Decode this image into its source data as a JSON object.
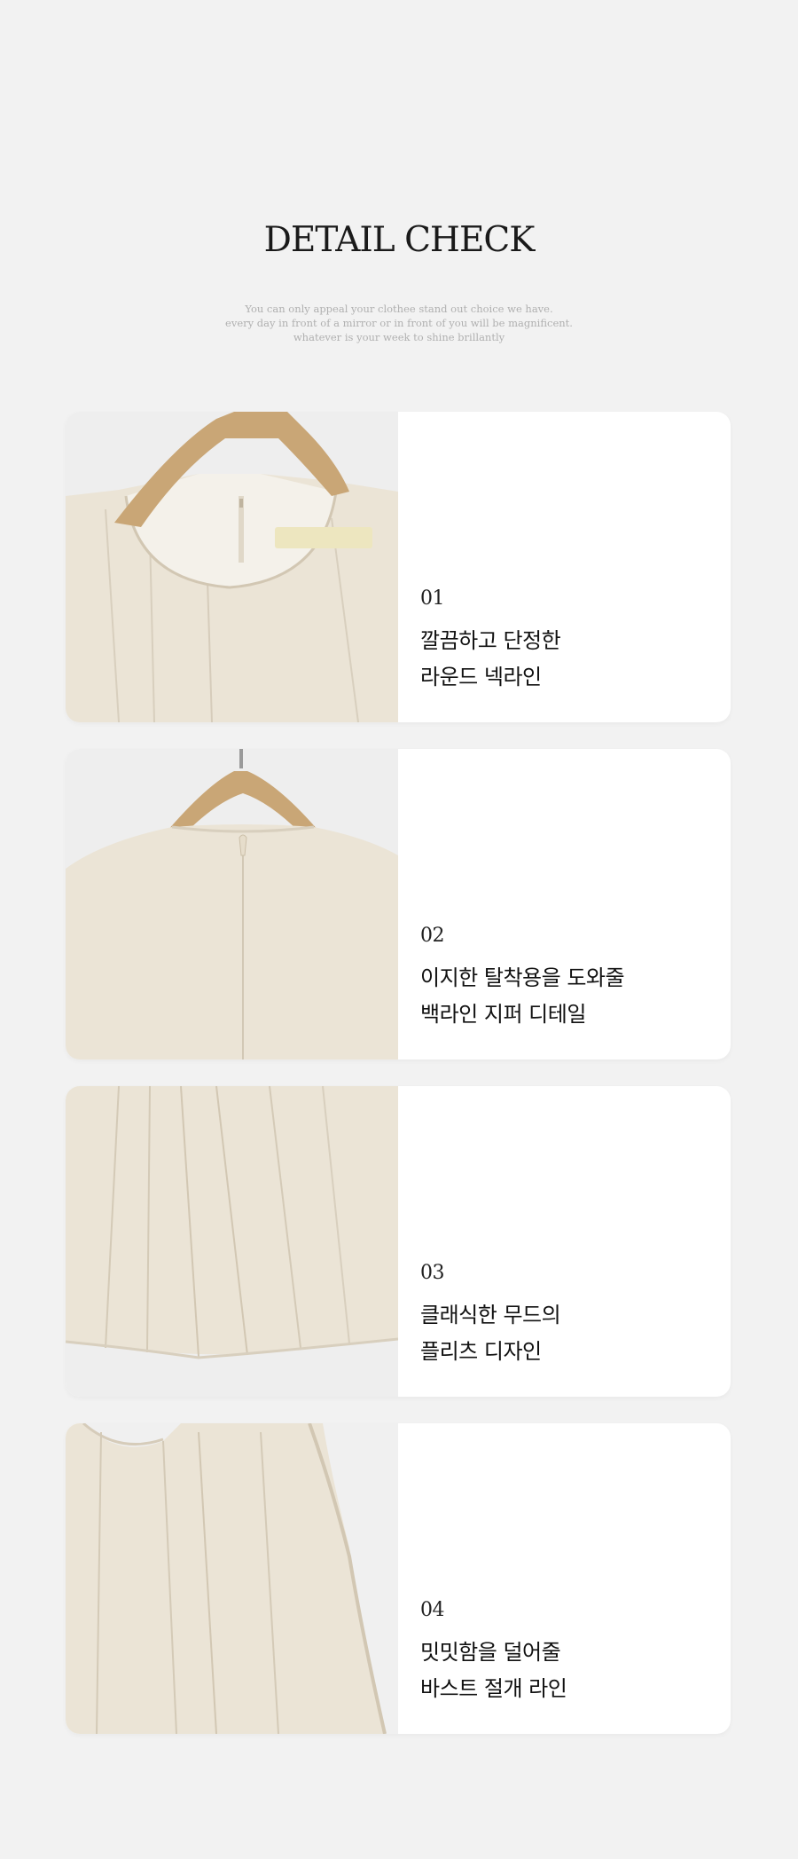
{
  "header": {
    "title": "DETAIL CHECK",
    "subtitle_lines": [
      "You can only appeal your clothee stand out choice we have.",
      "every day in front of a mirror or in front of you will be magnificent.",
      "whatever is your week to shine brillantly"
    ]
  },
  "details": [
    {
      "number": "01",
      "line1": "깔끔하고 단정한",
      "line2": "라운드 넥라인",
      "image": "round-neckline-photo"
    },
    {
      "number": "02",
      "line1": "이지한 탈착용을 도와줄",
      "line2": "백라인 지퍼 디테일",
      "image": "back-zipper-photo"
    },
    {
      "number": "03",
      "line1": "클래식한 무드의",
      "line2": "플리츠 디자인",
      "image": "pleats-photo"
    },
    {
      "number": "04",
      "line1": "밋밋함을 덜어줄",
      "line2": "바스트 절개 라인",
      "image": "bust-seam-photo"
    }
  ],
  "colors": {
    "background": "#f2f2f2",
    "card": "#ffffff",
    "fabric": "#ebe4d6",
    "hanger": "#c9a676"
  }
}
